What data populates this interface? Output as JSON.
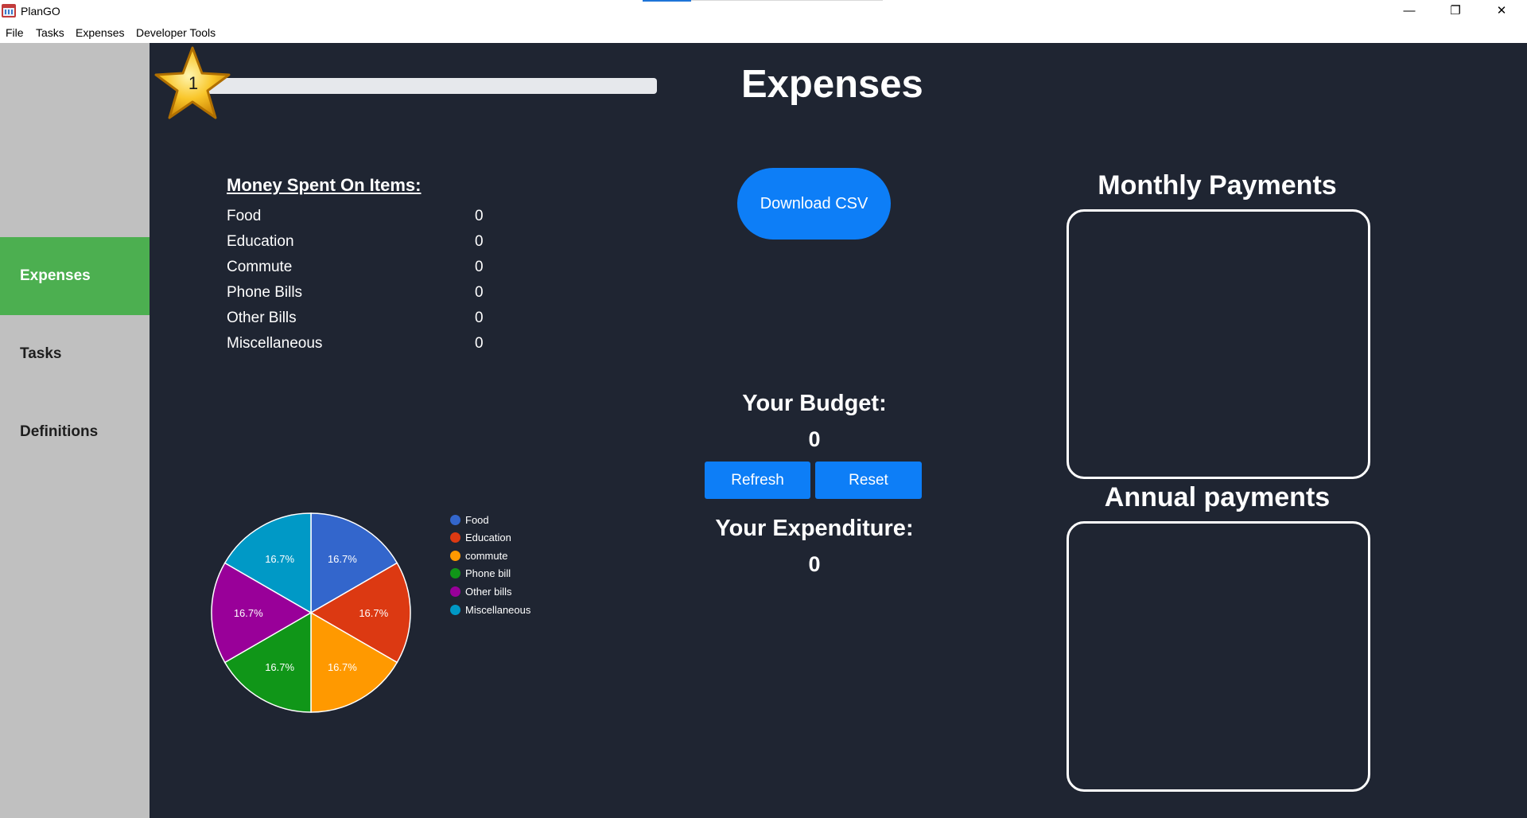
{
  "window": {
    "title": "PlanGO",
    "minimize": "—",
    "maximize": "❐",
    "close": "✕"
  },
  "menu": [
    "File",
    "Tasks",
    "Expenses",
    "Developer Tools"
  ],
  "sidebar": {
    "items": [
      {
        "label": "Expenses",
        "active": true
      },
      {
        "label": "Tasks",
        "active": false
      },
      {
        "label": "Definitions",
        "active": false
      }
    ]
  },
  "progress": {
    "level": "1",
    "fill_fraction": 0.0
  },
  "page": {
    "title": "Expenses"
  },
  "money_spent": {
    "heading": "Money Spent On Items:",
    "items": [
      {
        "label": "Food",
        "value": "0"
      },
      {
        "label": "Education",
        "value": "0"
      },
      {
        "label": "Commute",
        "value": "0"
      },
      {
        "label": "Phone Bills",
        "value": "0"
      },
      {
        "label": "Other Bills",
        "value": "0"
      },
      {
        "label": "Miscellaneous",
        "value": "0"
      }
    ]
  },
  "actions": {
    "download_csv": "Download CSV",
    "refresh": "Refresh",
    "reset": "Reset"
  },
  "budget": {
    "label": "Your Budget:",
    "value": "0"
  },
  "expenditure": {
    "label": "Your Expenditure:",
    "value": "0"
  },
  "monthly": {
    "title": "Monthly Payments"
  },
  "annual": {
    "title": "Annual payments"
  },
  "colors": {
    "accent": "#0d7ef7",
    "sidebar_active": "#4caf50",
    "background": "#1f2532"
  },
  "chart_data": {
    "type": "pie",
    "categories": [
      "Food",
      "Education",
      "commute",
      "Phone bill",
      "Other bills",
      "Miscellaneous"
    ],
    "values": [
      16.7,
      16.7,
      16.7,
      16.7,
      16.7,
      16.7
    ],
    "labels": [
      "16.7%",
      "16.7%",
      "16.7%",
      "16.7%",
      "16.7%",
      "16.7%"
    ],
    "colors": [
      "#3366cc",
      "#dc3912",
      "#ff9900",
      "#109618",
      "#990099",
      "#0099c6"
    ],
    "legend": "right"
  }
}
